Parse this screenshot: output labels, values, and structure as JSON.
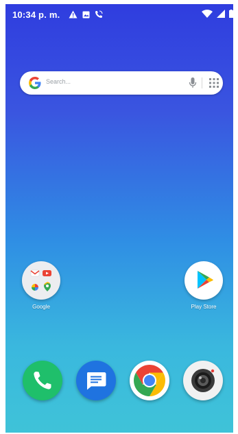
{
  "status_bar": {
    "time": "10:34 p. m.",
    "left_icons": [
      "warning-icon",
      "gallery-icon",
      "phone-call-icon"
    ],
    "right_icons": [
      "wifi-icon",
      "signal-icon",
      "battery-icon"
    ]
  },
  "search": {
    "placeholder": "Search...",
    "icons": [
      "google-g-icon",
      "mic-icon",
      "apps-grid-icon"
    ]
  },
  "home_apps": [
    {
      "label": "Google",
      "icon": "google-folder-icon"
    },
    {
      "label": "Play Store",
      "icon": "play-store-icon"
    }
  ],
  "dock": [
    {
      "icon": "phone-app-icon"
    },
    {
      "icon": "messages-app-icon"
    },
    {
      "icon": "chrome-app-icon"
    },
    {
      "icon": "camera-app-icon"
    }
  ],
  "colors": {
    "background_top": "#2f3ddf",
    "background_bottom": "#3fc3d8"
  }
}
